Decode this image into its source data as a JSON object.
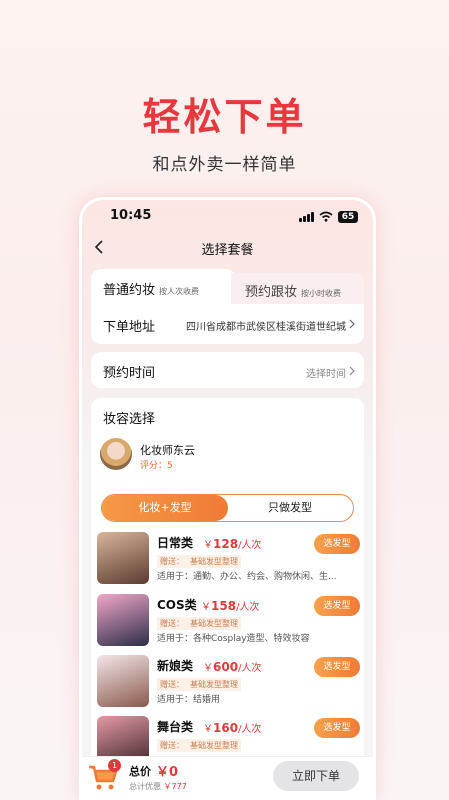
{
  "promo": {
    "headline": "轻松下单",
    "subline": "和点外卖一样简单"
  },
  "status_bar": {
    "time": "10:45",
    "battery": "65"
  },
  "nav": {
    "title": "选择套餐"
  },
  "service_tabs": [
    {
      "label": "普通约妆",
      "sub": "按人次收费",
      "active": true
    },
    {
      "label": "预约跟妆",
      "sub": "按小时收费",
      "active": false
    }
  ],
  "address": {
    "label": "下单地址",
    "value": "四川省成都市武侯区桂溪街道世纪城"
  },
  "booking_time": {
    "label": "预约时间",
    "value": "选择时间"
  },
  "makeup": {
    "title": "妆容选择",
    "artist": {
      "name": "化妆师东云",
      "score": "评分：5"
    },
    "toggle": {
      "active": "化妆+发型",
      "other": "只做发型"
    },
    "packages": [
      {
        "name": "日常类",
        "price": "128",
        "currency": "￥",
        "unit": "/人次",
        "gift_label": "赠送：",
        "gift": "基础发型整理",
        "usage": "适用于：通勤、办公、约会、购物休闲、生...",
        "button": "选发型",
        "colors": [
          "#d9b59c",
          "#5b3b2e"
        ]
      },
      {
        "name": "COS类",
        "price": "158",
        "currency": "￥",
        "unit": "/人次",
        "gift_label": "赠送：",
        "gift": "基础发型整理",
        "usage": "适用于：各种Cosplay造型、特效妆容",
        "button": "选发型",
        "colors": [
          "#f3a8c8",
          "#2b2d4a"
        ]
      },
      {
        "name": "新娘类",
        "price": "600",
        "currency": "￥",
        "unit": "/人次",
        "gift_label": "赠送：",
        "gift": "基础发型整理",
        "usage": "适用于：结婚用",
        "button": "选发型",
        "colors": [
          "#f4e6e8",
          "#8a5a4e"
        ]
      },
      {
        "name": "舞台类",
        "price": "160",
        "currency": "￥",
        "unit": "/人次",
        "gift_label": "赠送：",
        "gift": "基础发型整理",
        "usage": "",
        "button": "选发型",
        "colors": [
          "#e39aa7",
          "#3a2225"
        ]
      }
    ]
  },
  "cart": {
    "badge": "1",
    "total_label": "总价",
    "total_price": "￥0",
    "discount_label": "总计优惠",
    "discount_value": "￥777",
    "order_button": "立即下单"
  },
  "theme": {
    "accent": "#e8383e",
    "orange": "#f07a37"
  }
}
